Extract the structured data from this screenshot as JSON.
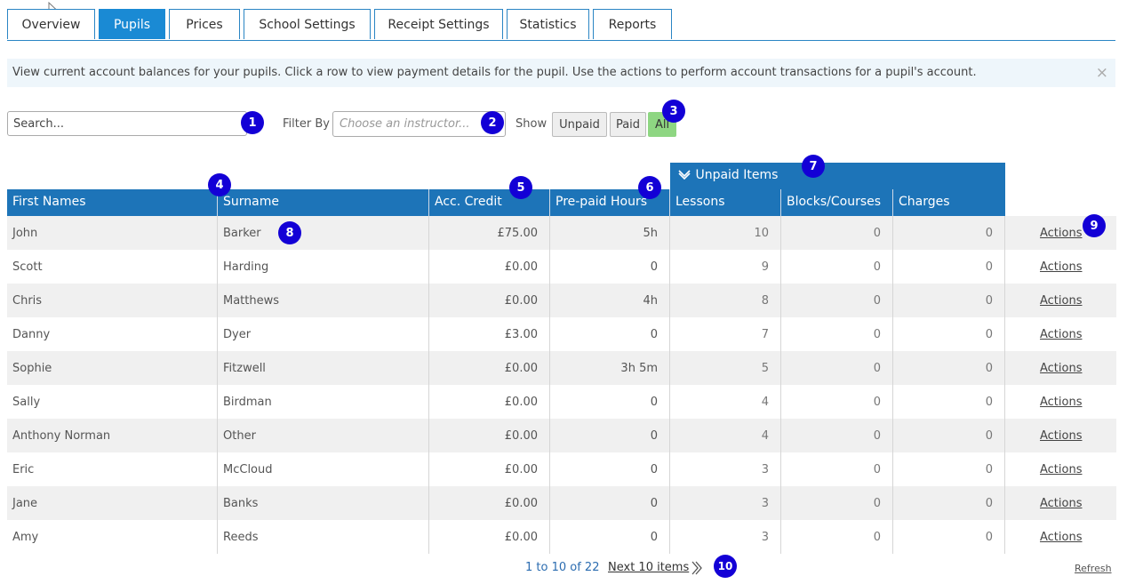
{
  "tabs": [
    {
      "label": "Overview",
      "active": false
    },
    {
      "label": "Pupils",
      "active": true
    },
    {
      "label": "Prices",
      "active": false
    },
    {
      "label": "School Settings",
      "active": false
    },
    {
      "label": "Receipt Settings",
      "active": false
    },
    {
      "label": "Statistics",
      "active": false
    },
    {
      "label": "Reports",
      "active": false
    }
  ],
  "info": {
    "text": "View current account balances for your pupils. Click a row to view payment details for the pupil. Use the actions to perform account transactions for a pupil's account.",
    "close_glyph": "×"
  },
  "filters": {
    "search_placeholder": "Search...",
    "filter_by_label": "Filter By",
    "instructor_placeholder": "Choose an instructor...",
    "show_label": "Show",
    "show_options": [
      "Unpaid",
      "Paid",
      "All"
    ],
    "selected": "All"
  },
  "table": {
    "group_header": "Unpaid Items",
    "group_icon": "chevron-down-icon",
    "columns": [
      "First Names",
      "Surname",
      "Acc. Credit",
      "Pre-paid Hours",
      "Lessons",
      "Blocks/Courses",
      "Charges"
    ],
    "action_label": "Actions",
    "rows": [
      {
        "first": "John",
        "surname": "Barker",
        "credit": "£75.00",
        "hours": "5h",
        "lessons": "10",
        "blocks": "0",
        "charges": "0"
      },
      {
        "first": "Scott",
        "surname": "Harding",
        "credit": "£0.00",
        "hours": "0",
        "lessons": "9",
        "blocks": "0",
        "charges": "0"
      },
      {
        "first": "Chris",
        "surname": "Matthews",
        "credit": "£0.00",
        "hours": "4h",
        "lessons": "8",
        "blocks": "0",
        "charges": "0"
      },
      {
        "first": "Danny",
        "surname": "Dyer",
        "credit": "£3.00",
        "hours": "0",
        "lessons": "7",
        "blocks": "0",
        "charges": "0"
      },
      {
        "first": "Sophie",
        "surname": "Fitzwell",
        "credit": "£0.00",
        "hours": "3h 5m",
        "lessons": "5",
        "blocks": "0",
        "charges": "0"
      },
      {
        "first": "Sally",
        "surname": "Birdman",
        "credit": "£0.00",
        "hours": "0",
        "lessons": "4",
        "blocks": "0",
        "charges": "0"
      },
      {
        "first": "Anthony Norman",
        "surname": "Other",
        "credit": "£0.00",
        "hours": "0",
        "lessons": "4",
        "blocks": "0",
        "charges": "0"
      },
      {
        "first": "Eric",
        "surname": "McCloud",
        "credit": "£0.00",
        "hours": "0",
        "lessons": "3",
        "blocks": "0",
        "charges": "0"
      },
      {
        "first": "Jane",
        "surname": "Banks",
        "credit": "£0.00",
        "hours": "0",
        "lessons": "3",
        "blocks": "0",
        "charges": "0"
      },
      {
        "first": "Amy",
        "surname": "Reeds",
        "credit": "£0.00",
        "hours": "0",
        "lessons": "3",
        "blocks": "0",
        "charges": "0"
      }
    ]
  },
  "pager": {
    "range": "1 to 10 of 22",
    "next_label": "Next 10 items",
    "next_glyph": "»",
    "refresh_label": "Refresh"
  },
  "badges": [
    "1",
    "2",
    "3",
    "4",
    "5",
    "6",
    "7",
    "8",
    "9",
    "10"
  ],
  "colors": {
    "accent": "#1d74b8",
    "tab_active": "#1a8ad4",
    "show_selected": "#8ed682",
    "badge": "#1300d6"
  }
}
